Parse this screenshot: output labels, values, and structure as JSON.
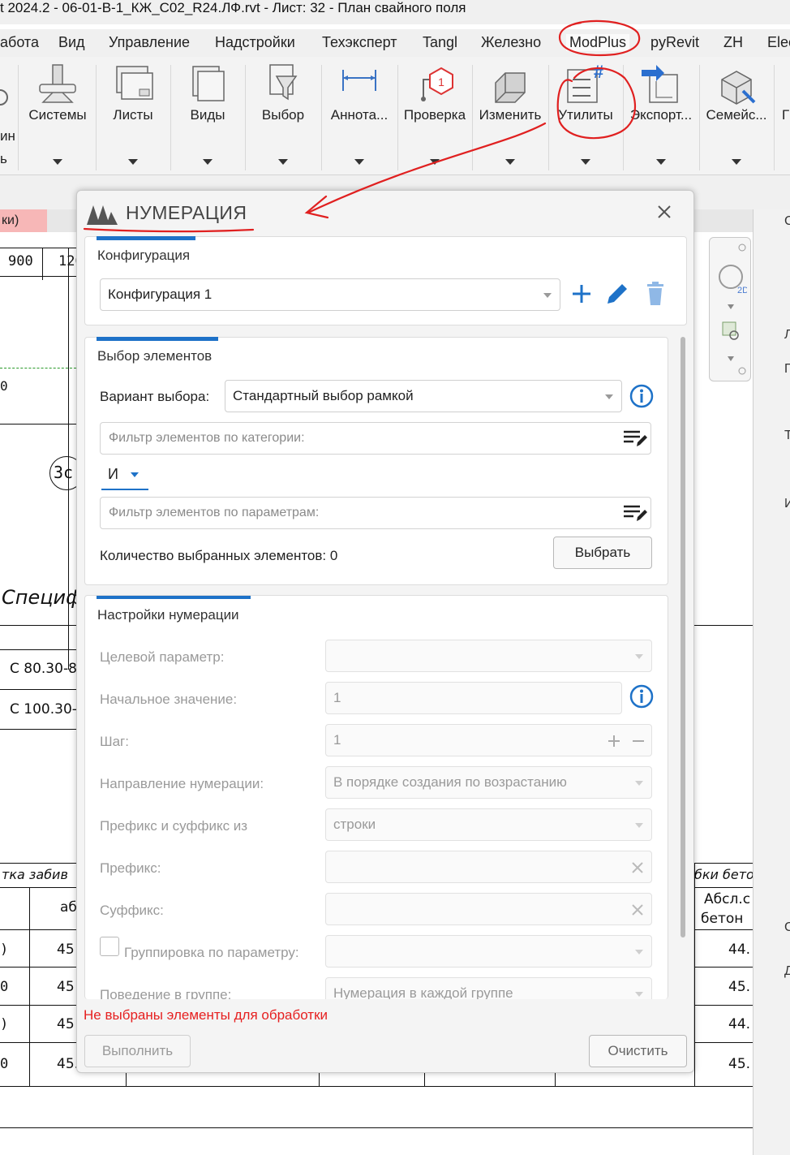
{
  "window": {
    "title": "t 2024.2 - 06-01-В-1_КЖ_С02_R24.ЛФ.rvt - Лист: 32 - План свайного поля"
  },
  "tabs": [
    "абота",
    "Вид",
    "Управление",
    "Надстройки",
    "Техэксперт",
    "Tangl",
    "Железно",
    "ModPlus",
    "pyRevit",
    "ZH",
    "Elec"
  ],
  "ribbon": {
    "left_partial": [
      "ин",
      "ь"
    ],
    "buttons": [
      "Системы",
      "Листы",
      "Виды",
      "Выбор",
      "Аннота...",
      "Проверка",
      "Изменить",
      "Утилиты",
      "Экспорт...",
      "Семейс...",
      "Г"
    ],
    "badge": "1"
  },
  "view_tab": {
    "label": "ки)"
  },
  "drawing": {
    "dims": [
      "900",
      "120"
    ],
    "marker": "3с",
    "spec_heading": "Специф",
    "rows": [
      "С 80.30-8",
      "С 100.30-"
    ],
    "col_left": "тка забив",
    "col_left_sub": "аб",
    "col_right": "бки бето",
    "col_right_sub1": "Абсл.с",
    "col_right_sub2": "бетон",
    "left_values": [
      "45",
      "45",
      "45",
      "45."
    ],
    "left_row_marks": [
      ")",
      "0",
      ")",
      "0"
    ],
    "right_values": [
      "44.",
      "45.",
      "44.",
      "45."
    ],
    "right_letters": [
      "С",
      "Л",
      "П",
      "Т",
      "И",
      "С",
      "Д"
    ]
  },
  "nav_bar": {
    "badge": "2D"
  },
  "dialog": {
    "title": "НУМЕРАЦИЯ",
    "config": {
      "section_title": "Конфигурация",
      "selected": "Конфигурация 1"
    },
    "selection": {
      "section_title": "Выбор элементов",
      "variant_label": "Вариант выбора:",
      "variant_value": "Стандартный выбор рамкой",
      "category_filter_placeholder": "Фильтр элементов по категории:",
      "logic_value": "И",
      "param_filter_placeholder": "Фильтр элементов по параметрам:",
      "count_label": "Количество выбранных элементов: 0",
      "select_button": "Выбрать"
    },
    "numbering": {
      "section_title": "Настройки нумерации",
      "target_param_label": "Целевой параметр:",
      "target_param_value": "",
      "start_label": "Начальное значение:",
      "start_value": "1",
      "step_label": "Шаг:",
      "step_value": "1",
      "direction_label": "Направление нумерации:",
      "direction_value": "В порядке создания по возрастанию",
      "prefix_source_label": "Префикс и суффикс из",
      "prefix_source_value": "строки",
      "prefix_label": "Префикс:",
      "prefix_value": "",
      "suffix_label": "Суффикс:",
      "suffix_value": "",
      "grouping_label": "Группировка по параметру:",
      "grouping_checked": false,
      "group_behavior_label": "Поведение в группе:",
      "group_behavior_value": "Нумерация в каждой группе"
    },
    "status_error": "Не выбраны элементы для обработки",
    "run_button": "Выполнить",
    "clear_button": "Очистить"
  },
  "colors": {
    "accent": "#1e72c8",
    "error": "#e62020",
    "annotation": "#e02020",
    "view_tab_active": "#f7b7b7"
  }
}
